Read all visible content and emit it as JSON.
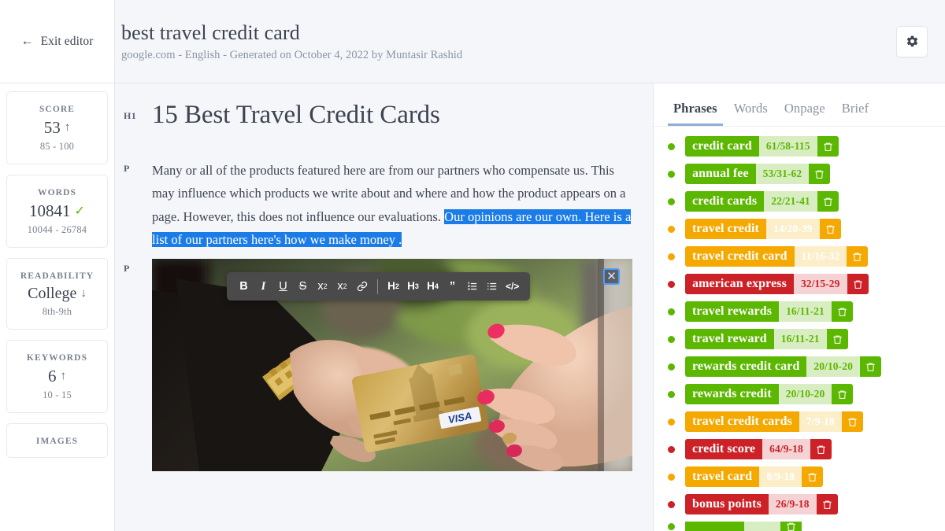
{
  "topbar": {
    "exit_label": "Exit editor",
    "back_icon": "arrow-left-icon",
    "doc_title": "best travel credit card",
    "doc_subtitle": "google.com - English - Generated on October 4, 2022 by Muntasir Rashid",
    "settings_icon": "gear-icon"
  },
  "metrics": [
    {
      "label": "SCORE",
      "value": "53",
      "trend": "↑",
      "range": "85 - 100"
    },
    {
      "label": "WORDS",
      "value": "10841",
      "trend": "✓",
      "range": "10044 - 26784"
    },
    {
      "label": "READABILITY",
      "value": "College",
      "trend": "↓",
      "range": "8th-9th"
    },
    {
      "label": "KEYWORDS",
      "value": "6",
      "trend": "↑",
      "range": "10 - 15"
    },
    {
      "label": "IMAGES",
      "value": "",
      "trend": "",
      "range": ""
    }
  ],
  "editor": {
    "blocks": [
      {
        "tag": "H1",
        "text": "15 Best Travel Credit Cards"
      }
    ],
    "paragraph": {
      "tag": "P",
      "plain": "Many or all of the products featured here are from our partners who compensate us. This may influence which products we write about and where and how the product appears on a page. However, this does not influence our evaluations. ",
      "selected": "Our opinions are our own. Here is a list of our partners here's how we make money ."
    },
    "image_block_tag": "P",
    "image_alt": "hand passing a gold VISA credit card to another hand",
    "image_close_icon": "close-icon",
    "image_close_label": "✕"
  },
  "toolbar": {
    "items": [
      {
        "name": "bold-button",
        "label": "B",
        "style": "bold"
      },
      {
        "name": "italic-button",
        "label": "I",
        "style": "ital"
      },
      {
        "name": "underline-button",
        "label": "U",
        "style": "under"
      },
      {
        "name": "strikethrough-button",
        "label": "S",
        "style": "strike"
      },
      {
        "name": "superscript-button",
        "label": "x",
        "style": "sup",
        "affix": "2"
      },
      {
        "name": "subscript-button",
        "label": "x",
        "style": "sub",
        "affix": "2"
      },
      {
        "name": "link-icon",
        "label": "ὑ7",
        "style": "link"
      },
      {
        "name": "toolbar-separator",
        "label": "",
        "style": "sep"
      },
      {
        "name": "heading-2-button",
        "label": "H",
        "style": "hh",
        "affix": "2"
      },
      {
        "name": "heading-3-button",
        "label": "H",
        "style": "hh",
        "affix": "3"
      },
      {
        "name": "heading-4-button",
        "label": "H",
        "style": "hh",
        "affix": "4"
      },
      {
        "name": "blockquote-button",
        "label": "”",
        "style": "quote"
      },
      {
        "name": "ordered-list-button",
        "label": "",
        "style": "ol"
      },
      {
        "name": "unordered-list-button",
        "label": "",
        "style": "ul"
      },
      {
        "name": "code-button",
        "label": "</>",
        "style": "code"
      }
    ]
  },
  "right_panel": {
    "tabs": [
      {
        "label": "Phrases",
        "active": true
      },
      {
        "label": "Words",
        "active": false
      },
      {
        "label": "Onpage",
        "active": false
      },
      {
        "label": "Brief",
        "active": false
      }
    ],
    "colors": {
      "green": "#5cb700",
      "green_light": "#d9edc2",
      "green_text": "#5cb700",
      "orange": "#f5a800",
      "orange_light": "#fceec8",
      "orange_text": "#ffffff",
      "red": "#cc2127",
      "red_light": "#f5d2d4",
      "red_text": "#cc2127"
    },
    "delete_icon": "trash-icon",
    "keywords": [
      {
        "phrase": "credit card",
        "count": "61/58-115",
        "status": "green"
      },
      {
        "phrase": "annual fee",
        "count": "53/31-62",
        "status": "green"
      },
      {
        "phrase": "credit cards",
        "count": "22/21-41",
        "status": "green"
      },
      {
        "phrase": "travel credit",
        "count": "14/20-39",
        "status": "orange"
      },
      {
        "phrase": "travel credit card",
        "count": "11/16-32",
        "status": "orange"
      },
      {
        "phrase": "american express",
        "count": "32/15-29",
        "status": "red"
      },
      {
        "phrase": "travel rewards",
        "count": "16/11-21",
        "status": "green"
      },
      {
        "phrase": "travel reward",
        "count": "16/11-21",
        "status": "green"
      },
      {
        "phrase": "rewards credit card",
        "count": "20/10-20",
        "status": "green"
      },
      {
        "phrase": "rewards credit",
        "count": "20/10-20",
        "status": "green"
      },
      {
        "phrase": "travel credit cards",
        "count": "7/9-18",
        "status": "orange"
      },
      {
        "phrase": "credit score",
        "count": "64/9-18",
        "status": "red"
      },
      {
        "phrase": "travel card",
        "count": "8/9-18",
        "status": "orange"
      },
      {
        "phrase": "bonus points",
        "count": "26/9-18",
        "status": "red"
      },
      {
        "phrase": "",
        "count": "",
        "status": "green",
        "cut": true
      }
    ]
  }
}
